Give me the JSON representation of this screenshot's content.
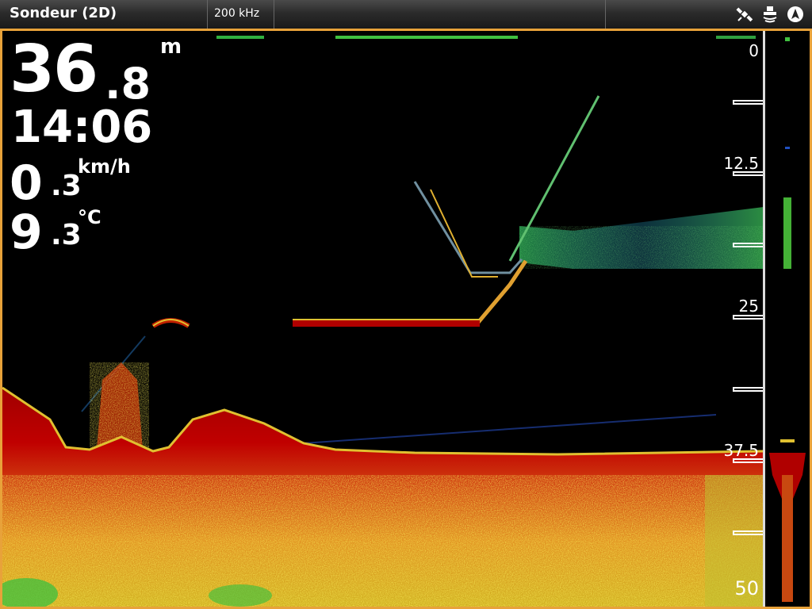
{
  "header": {
    "title": "Sondeur (2D)",
    "frequency": "200 kHz",
    "icons": [
      "gps-satellite-icon",
      "sonar-transducer-icon",
      "navigation-arrow-icon"
    ]
  },
  "readouts": {
    "depth_int": "36",
    "depth_dec": ".8",
    "depth_unit": "m",
    "time": "14:06",
    "speed_int": "0",
    "speed_dec": ".3",
    "speed_unit": "km/h",
    "temp_int": "9",
    "temp_dec": ".3",
    "temp_unit": "°C"
  },
  "depth_scale": {
    "labels": [
      "0",
      "12.5",
      "25",
      "37.5",
      "50"
    ],
    "max": 50,
    "bottom_depth": 36.8
  },
  "colors": {
    "accent_border": "#e8a23a",
    "strong_return": "#a00000",
    "medium_return": "#e8c030",
    "weak_return": "#40c040",
    "faint_return": "#2040c0"
  }
}
